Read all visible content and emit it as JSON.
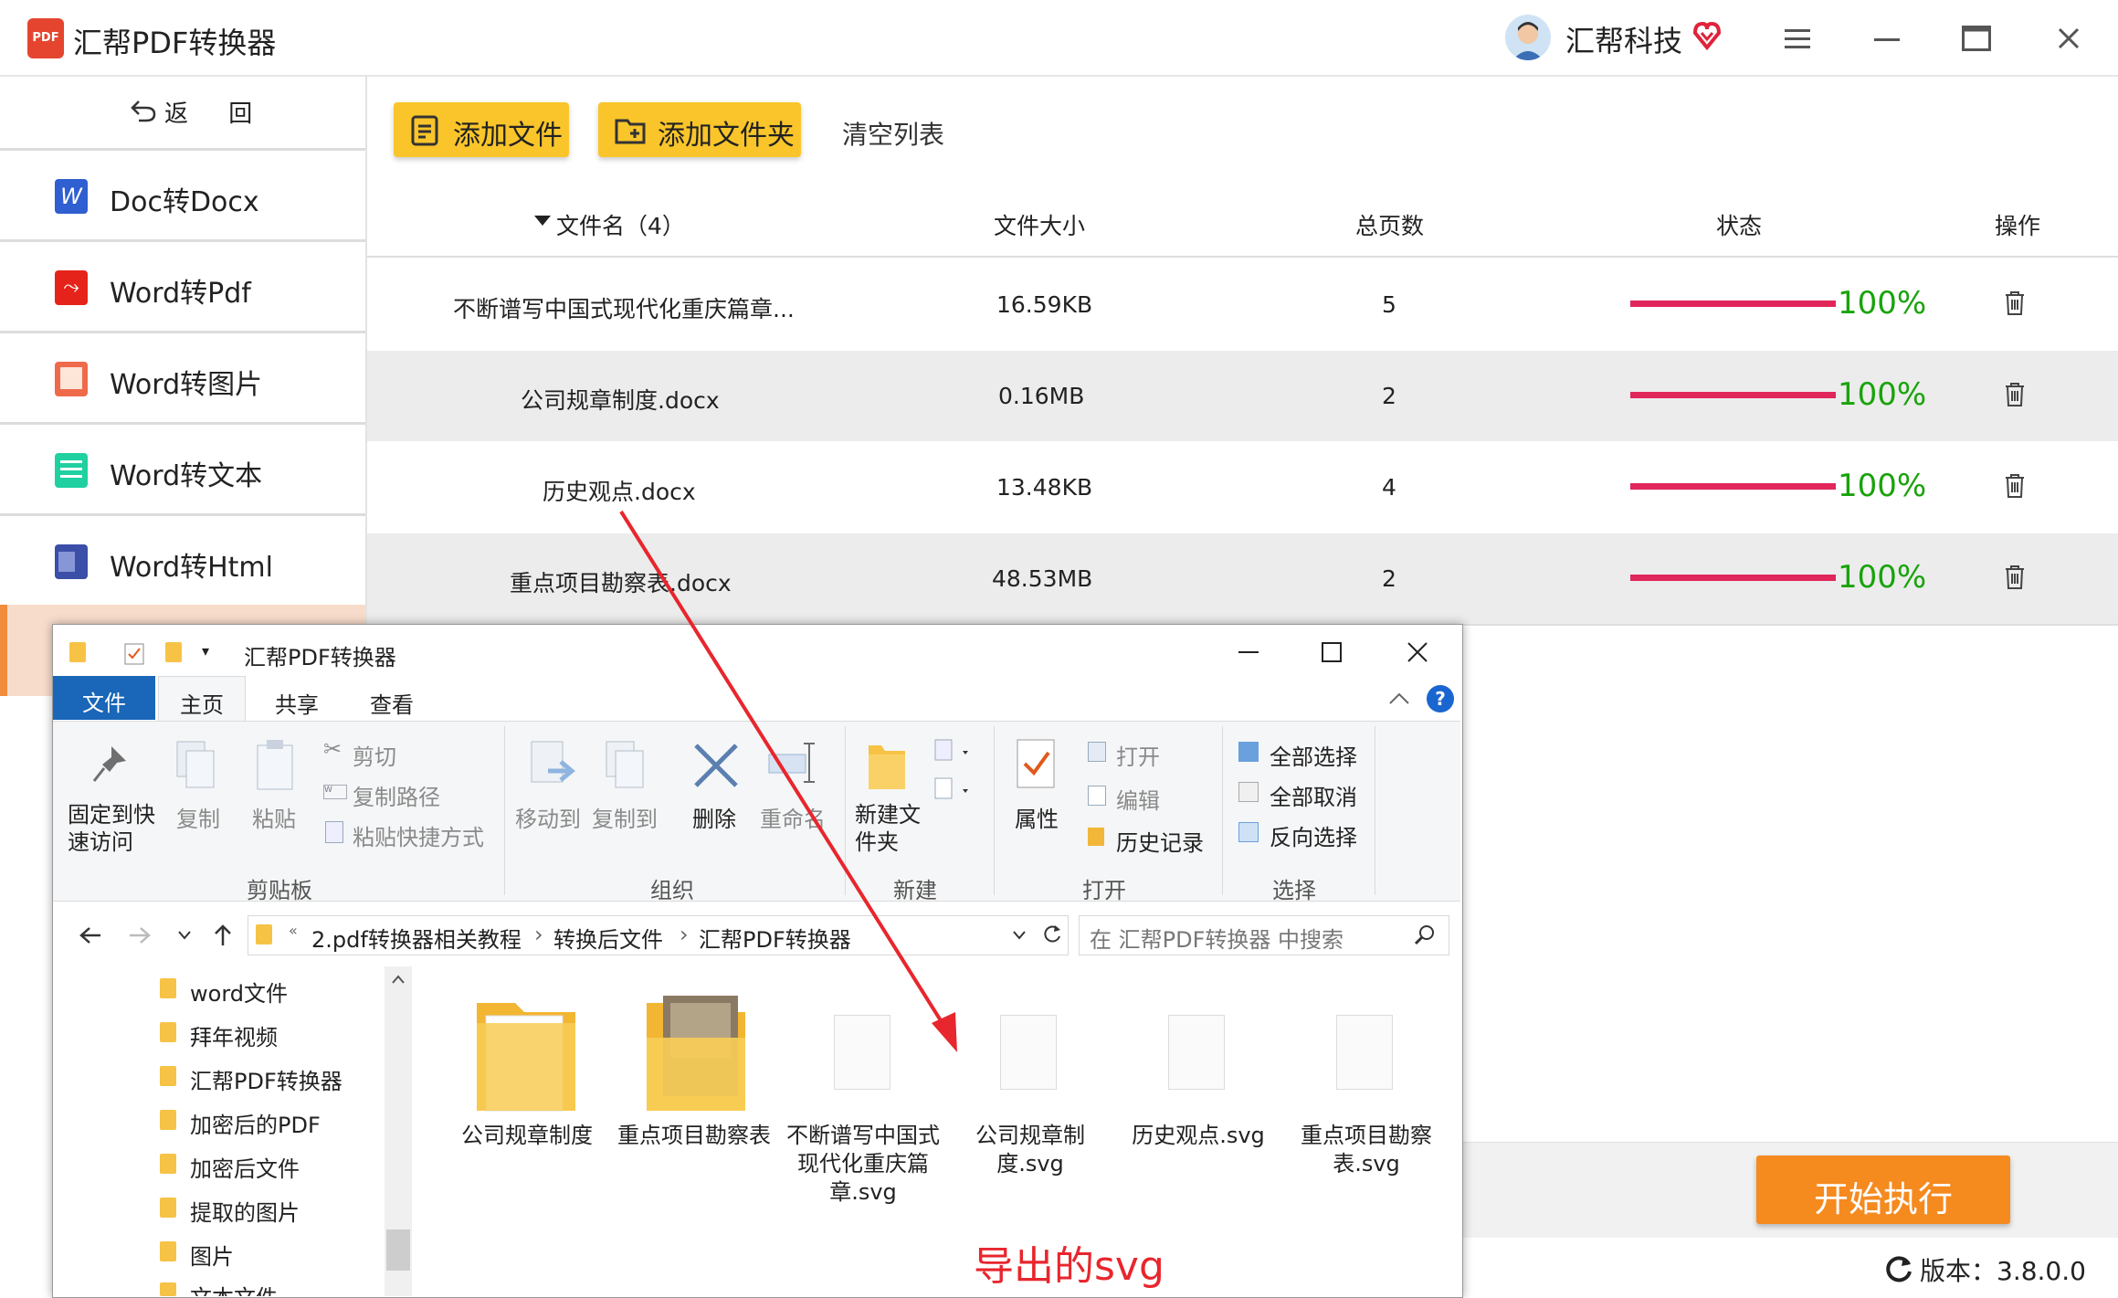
{
  "app": {
    "title": "汇帮PDF转换器",
    "logo_text": "PDF",
    "user_name": "汇帮科技"
  },
  "sidebar": {
    "back_label": "返 回",
    "items": [
      {
        "label": "Doc转Docx",
        "icon": "word-icon",
        "color": "#2f5fd0"
      },
      {
        "label": "Word转Pdf",
        "icon": "pdf-icon",
        "color": "#e5231b"
      },
      {
        "label": "Word转图片",
        "icon": "image-icon",
        "color": "#ef6a4a"
      },
      {
        "label": "Word转文本",
        "icon": "text-icon",
        "color": "#1fd0a0"
      },
      {
        "label": "Word转Html",
        "icon": "html-icon",
        "color": "#3b4fa8"
      }
    ]
  },
  "toolbar": {
    "add_file": "添加文件",
    "add_folder": "添加文件夹",
    "clear": "清空列表"
  },
  "table": {
    "headers": {
      "name": "文件名（4）",
      "size": "文件大小",
      "pages": "总页数",
      "status": "状态",
      "action": "操作"
    },
    "rows": [
      {
        "name": "不断谱写中国式现代化重庆篇章...",
        "size": "16.59KB",
        "pages": "5",
        "progress": 1.0,
        "pct": "100%"
      },
      {
        "name": "公司规章制度.docx",
        "size": "0.16MB",
        "pages": "2",
        "progress": 1.0,
        "pct": "100%"
      },
      {
        "name": "历史观点.docx",
        "size": "13.48KB",
        "pages": "4",
        "progress": 1.0,
        "pct": "100%"
      },
      {
        "name": "重点项目勘察表.docx",
        "size": "48.53MB",
        "pages": "2",
        "progress": 1.0,
        "pct": "100%"
      }
    ]
  },
  "explorer": {
    "title": "汇帮PDF转换器",
    "tabs": [
      "文件",
      "主页",
      "共享",
      "查看"
    ],
    "ribbon": {
      "clipboard": {
        "pin": "固定到快速访问",
        "copy": "复制",
        "paste": "粘贴",
        "cut": "剪切",
        "copy_path": "复制路径",
        "paste_shortcut": "粘贴快捷方式",
        "group": "剪贴板"
      },
      "organize": {
        "move_to": "移动到",
        "copy_to": "复制到",
        "delete": "删除",
        "rename": "重命名",
        "group": "组织"
      },
      "new": {
        "new_folder": "新建文件夹",
        "group": "新建"
      },
      "open": {
        "properties": "属性",
        "open": "打开",
        "edit": "编辑",
        "history": "历史记录",
        "group": "打开"
      },
      "select": {
        "select_all": "全部选择",
        "select_none": "全部取消",
        "invert": "反向选择",
        "group": "选择"
      }
    },
    "address": {
      "path": [
        "2.pdf转换器相关教程",
        "转换后文件",
        "汇帮PDF转换器"
      ],
      "search_placeholder": "在 汇帮PDF转换器 中搜索"
    },
    "nav_items": [
      "word文件",
      "拜年视频",
      "汇帮PDF转换器",
      "加密后的PDF",
      "加密后文件",
      "提取的图片",
      "图片",
      "文本文件"
    ],
    "files": [
      {
        "name": "公司规章制度",
        "kind": "folder"
      },
      {
        "name": "重点项目勘察表",
        "kind": "folder-photo"
      },
      {
        "name": "不断谱写中国式现代化重庆篇章.svg",
        "kind": "svg"
      },
      {
        "name": "公司规章制度.svg",
        "kind": "svg"
      },
      {
        "name": "历史观点.svg",
        "kind": "svg"
      },
      {
        "name": "重点项目勘察表.svg",
        "kind": "svg"
      }
    ]
  },
  "annotation": {
    "caption": "导出的svg",
    "color": "#e8262d"
  },
  "footer": {
    "run_label": "开始执行",
    "version": "版本：3.8.0.0"
  }
}
